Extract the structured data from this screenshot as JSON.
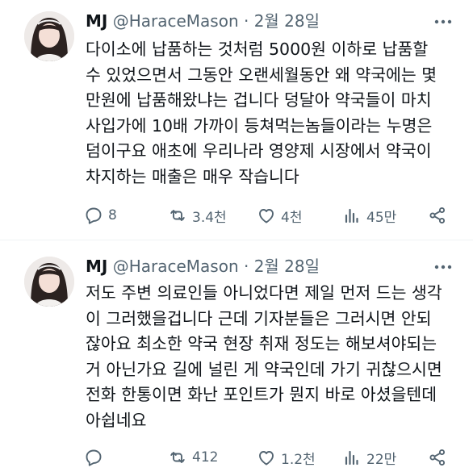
{
  "tweets": [
    {
      "author": {
        "name": "MJ",
        "handle": "@HaraceMason",
        "separator": "·",
        "date": "2월 28일"
      },
      "text_lines": [
        "다이소에 납품하는 것처럼 5000원 이하로 납품할",
        "수 있었으면서  그동안 오랜세월동안 왜 약국에는 몇",
        "만원에 납품해왔냐는 겁니다  덩달아 약국들이 마치",
        "사입가에 10배 가까이 등쳐먹는놈들이라는 누명은",
        "덤이구요  애초에 우리나라 영양제 시장에서 약국이",
        "차지하는 매출은 매우 작습니다"
      ],
      "actions": {
        "replies": "8",
        "reposts": "3.4천",
        "likes": "4천",
        "views": "45만"
      }
    },
    {
      "author": {
        "name": "MJ",
        "handle": "@HaraceMason",
        "separator": "·",
        "date": "2월 28일"
      },
      "text_lines": [
        "저도 주변 의료인들 아니었다면 제일 먼저 드는 생각",
        "이 그러했을겁니다  근데 기자분들은 그러시면 안되",
        "잖아요  최소한 약국 현장 취재 정도는 해보셔야되는",
        "거 아닌가요  길에 널린 게 약국인데 가기 귀찮으시면",
        "전화 한통이면 화난 포인트가 뭔지 바로 아셨을텐데",
        "아쉽네요"
      ],
      "actions": {
        "replies": "",
        "reposts": "412",
        "likes": "1.2천",
        "views": "22만"
      }
    }
  ],
  "icons": [
    "more-icon",
    "reply-icon",
    "repost-icon",
    "like-icon",
    "views-icon",
    "share-icon"
  ],
  "colors": {
    "text": "#0f1419",
    "secondary": "#536471",
    "divider": "#eff3f4"
  }
}
